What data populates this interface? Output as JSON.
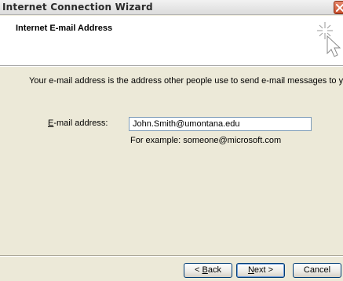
{
  "window": {
    "title": "Internet Connection Wizard"
  },
  "header": {
    "title": "Internet E-mail Address",
    "icon": "wizard-cursor-sparkle-icon"
  },
  "main": {
    "description": "Your e-mail address is the address other people use to send e-mail messages to you.",
    "email_label_accel": "E",
    "email_label_rest": "-mail address:",
    "email_value": "John.Smith@umontana.edu",
    "example_text": "For example: someone@microsoft.com"
  },
  "buttons": {
    "back_prefix": "< ",
    "back_accel": "B",
    "back_rest": "ack",
    "next_accel": "N",
    "next_rest": "ext >",
    "cancel_label": "Cancel"
  },
  "colors": {
    "dialog_bg": "#ece9d8",
    "header_bg": "#ffffff",
    "input_border": "#7f9db9",
    "close_button": "#c8502e"
  }
}
